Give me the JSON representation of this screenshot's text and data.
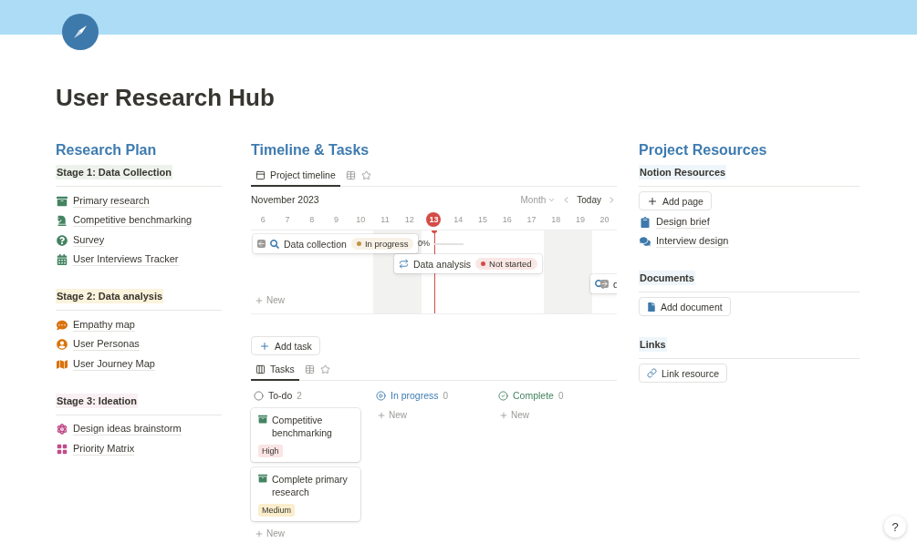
{
  "page": {
    "title": "User Research Hub"
  },
  "research_plan": {
    "title": "Research Plan",
    "stages": [
      {
        "label": "Stage 1: Data Collection",
        "color": "#edf3ec",
        "items": [
          "Primary research",
          "Competitive benchmarking",
          "Survey",
          "User Interviews Tracker"
        ]
      },
      {
        "label": "Stage 2: Data analysis",
        "color": "#fbf3db",
        "items": [
          "Empathy map",
          "User Personas",
          "User Journey Map"
        ]
      },
      {
        "label": "Stage 3: Ideation",
        "color": "#f9f0f3",
        "items": [
          "Design ideas brainstorm",
          "Priority Matrix"
        ]
      }
    ]
  },
  "timeline": {
    "title": "Timeline & Tasks",
    "tab": "Project timeline",
    "month": "November 2023",
    "view": "Month",
    "today": "Today",
    "days": [
      {
        "label": "6",
        "selected": false,
        "weekend": false
      },
      {
        "label": "7",
        "selected": false,
        "weekend": false
      },
      {
        "label": "8",
        "selected": false,
        "weekend": false
      },
      {
        "label": "9",
        "selected": false,
        "weekend": false
      },
      {
        "label": "10",
        "selected": false,
        "weekend": false
      },
      {
        "label": "11",
        "selected": false,
        "weekend": true
      },
      {
        "label": "12",
        "selected": false,
        "weekend": true
      },
      {
        "label": "13",
        "selected": true,
        "weekend": false
      },
      {
        "label": "14",
        "selected": false,
        "weekend": false
      },
      {
        "label": "15",
        "selected": false,
        "weekend": false
      },
      {
        "label": "16",
        "selected": false,
        "weekend": false
      },
      {
        "label": "17",
        "selected": false,
        "weekend": false
      },
      {
        "label": "18",
        "selected": false,
        "weekend": true
      },
      {
        "label": "19",
        "selected": false,
        "weekend": true
      },
      {
        "label": "20",
        "selected": false,
        "weekend": false
      }
    ],
    "items": [
      {
        "name": "Data collection",
        "status": {
          "label": "In progress",
          "color": "#c29343"
        },
        "progress": "0%",
        "level": 0
      },
      {
        "name": "Data analysis",
        "status": {
          "label": "Not started",
          "color": "#d44c47"
        }
      },
      {
        "name": "d"
      }
    ],
    "new_label": "New"
  },
  "add_task": "Add task",
  "tasks": {
    "tab": "Tasks",
    "columns": [
      {
        "kind": "todo",
        "label": "To-do",
        "count": "2",
        "cards": [
          {
            "title": "Competitive benchmarking",
            "tag": {
              "label": "High",
              "color": "#fbe4e4"
            }
          },
          {
            "title": "Complete primary research",
            "tag": {
              "label": "Medium",
              "color": "#fbeecc"
            }
          }
        ],
        "new_label": "New"
      },
      {
        "kind": "progress",
        "label": "In progress",
        "count": "0",
        "new_label": "New"
      },
      {
        "kind": "complete",
        "label": "Complete",
        "count": "0",
        "new_label": "New"
      }
    ]
  },
  "resources": {
    "title": "Project Resources",
    "sections": [
      {
        "label": "Notion Resources",
        "button": "Add page",
        "links": [
          "Design brief",
          "Interview design"
        ]
      },
      {
        "label": "Documents",
        "button": "Add document"
      },
      {
        "label": "Links",
        "button": "Link resource"
      }
    ]
  },
  "help": "?"
}
